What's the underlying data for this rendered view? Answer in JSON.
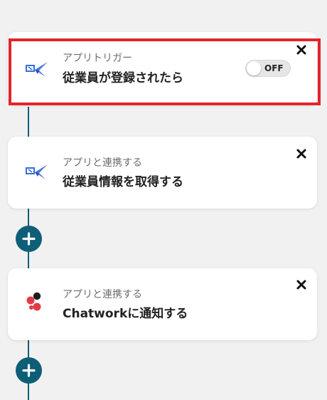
{
  "steps": [
    {
      "subtitle": "アプリトリガー",
      "title": "従業員が登録されたら",
      "icon": "paper-plane-app-icon",
      "toggle_label": "OFF",
      "highlighted": true
    },
    {
      "subtitle": "アプリと連携する",
      "title": "従業員情報を取得する",
      "icon": "paper-plane-app-icon"
    },
    {
      "subtitle": "アプリと連携する",
      "title": "Chatworkに通知する",
      "icon": "chatwork-icon"
    }
  ],
  "add_button_icon": "plus-icon",
  "close_button_icon": "close-icon",
  "colors": {
    "accent": "#0e5e78",
    "highlight": "#e3242b",
    "background": "#f1f1f1",
    "card": "#ffffff"
  }
}
